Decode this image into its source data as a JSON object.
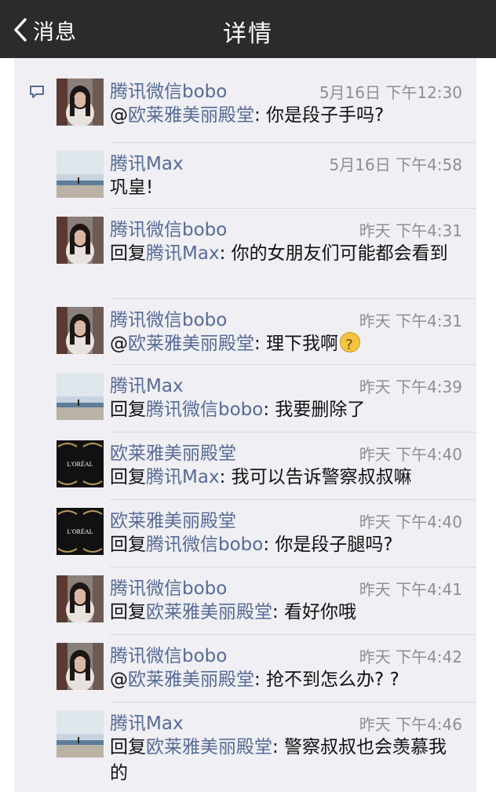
{
  "nav": {
    "back_label": "消息",
    "title": "详情"
  },
  "items": [
    {
      "name": "腾讯微信bobo",
      "time": "5月16日 下午12:30",
      "prefix": "@",
      "target": "欧莱雅美丽殿堂",
      "content": ": 你是段子手吗?",
      "avatar": "girl"
    },
    {
      "name": "腾讯Max",
      "time": "5月16日 下午4:58",
      "prefix": "",
      "target": "",
      "content": "巩皇!",
      "avatar": "sea"
    },
    {
      "name": "腾讯微信bobo",
      "time": "昨天 下午4:31",
      "prefix": "回复",
      "target": "腾讯Max",
      "content": ": 你的女朋友们可能都会看到",
      "avatar": "girl"
    },
    {
      "name": "腾讯微信bobo",
      "time": "昨天 下午4:31",
      "prefix": "@",
      "target": "欧莱雅美丽殿堂",
      "content": ": 理下我啊",
      "emoji": "thinking-emoji",
      "avatar": "girl"
    },
    {
      "name": "腾讯Max",
      "time": "昨天 下午4:39",
      "prefix": "回复",
      "target": "腾讯微信bobo",
      "content": ": 我要删除了",
      "avatar": "sea"
    },
    {
      "name": "欧莱雅美丽殿堂",
      "time": "昨天 下午4:40",
      "prefix": "回复",
      "target": "腾讯Max",
      "content": ": 我可以告诉警察叔叔嘛",
      "avatar": "loreal"
    },
    {
      "name": "欧莱雅美丽殿堂",
      "time": "昨天 下午4:40",
      "prefix": "回复",
      "target": "腾讯微信bobo",
      "content": ": 你是段子腿吗?",
      "avatar": "loreal"
    },
    {
      "name": "腾讯微信bobo",
      "time": "昨天 下午4:41",
      "prefix": "回复",
      "target": "欧莱雅美丽殿堂",
      "content": ": 看好你哦",
      "avatar": "girl"
    },
    {
      "name": "腾讯微信bobo",
      "time": "昨天 下午4:42",
      "prefix": "@",
      "target": "欧莱雅美丽殿堂",
      "content": ": 抢不到怎么办? ?",
      "avatar": "girl"
    },
    {
      "name": "腾讯Max",
      "time": "昨天 下午4:46",
      "prefix": "回复",
      "target": "欧莱雅美丽殿堂",
      "content": ": 警察叔叔也会羡慕我的",
      "avatar": "sea"
    }
  ],
  "loreal_logo_text": "L'ORÉAL",
  "colors": {
    "nav_bg": "#2b2b2d",
    "panel_bg": "#efeff4",
    "link": "#576b95",
    "time": "#8e8e93"
  }
}
